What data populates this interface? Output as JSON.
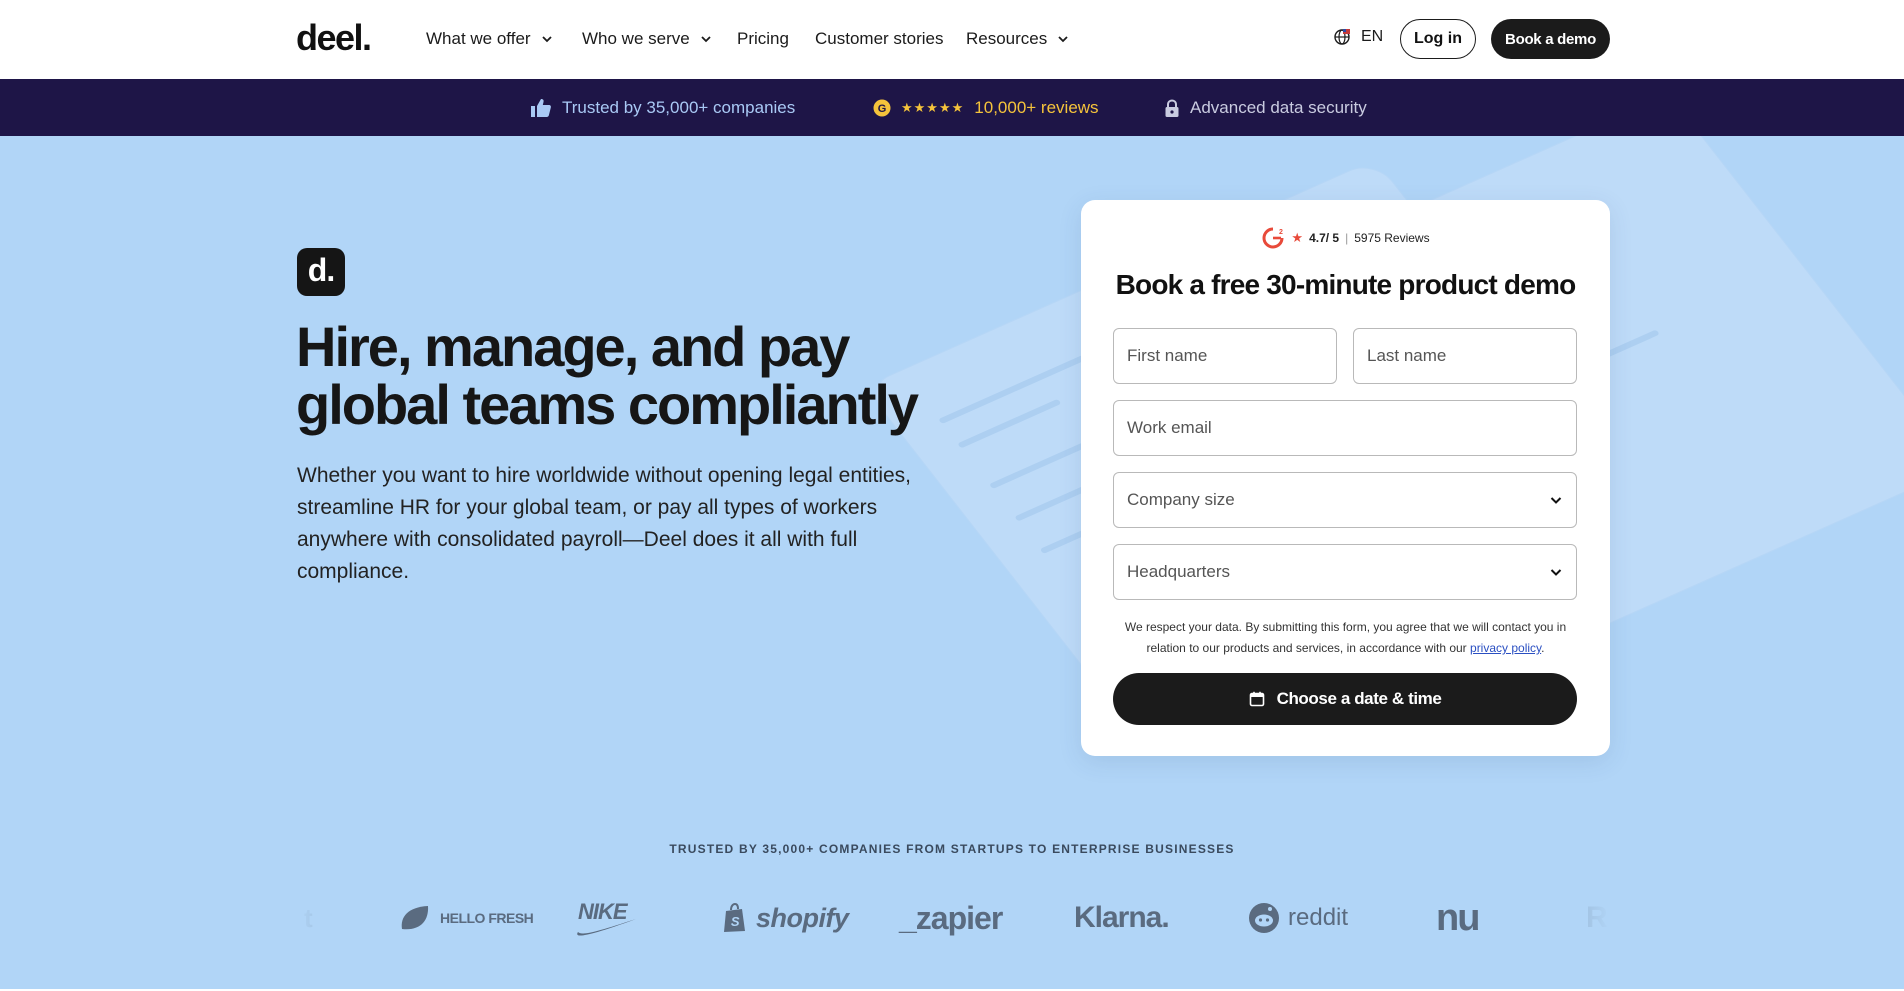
{
  "nav": {
    "logo": "deel.",
    "items": [
      {
        "label": "What we offer",
        "dropdown": true
      },
      {
        "label": "Who we serve",
        "dropdown": true
      },
      {
        "label": "Pricing",
        "dropdown": false
      },
      {
        "label": "Customer stories",
        "dropdown": false
      },
      {
        "label": "Resources",
        "dropdown": true
      }
    ],
    "language": "EN",
    "login_label": "Log in",
    "demo_label": "Book a demo"
  },
  "banner": {
    "trusted": "Trusted by 35,000+ companies",
    "stars": "★★★★★",
    "reviews": "10,000+ reviews",
    "security": "Advanced data security"
  },
  "hero": {
    "badge": "d.",
    "title": "Hire, manage, and pay global teams compliantly",
    "subtitle": "Whether you want to hire worldwide without opening legal entities, streamline HR for your global team, or pay all types of workers anywhere with consolidated payroll—Deel does it all with full compliance."
  },
  "form": {
    "rating_score": "4.7/ 5",
    "rating_sep": "|",
    "rating_reviews": "5975 Reviews",
    "title": "Book a free 30-minute  product demo",
    "first_name_placeholder": "First name",
    "last_name_placeholder": "Last name",
    "email_placeholder": "Work email",
    "company_size_placeholder": "Company size",
    "headquarters_placeholder": "Headquarters",
    "consent_text": "We respect your data. By submitting this form, you agree that we will contact you in relation to our products and services, in accordance with our ",
    "privacy_link": "privacy policy",
    "consent_end": ".",
    "submit_label": "Choose a date & time"
  },
  "logos": {
    "heading": "TRUSTED BY 35,000+ COMPANIES FROM STARTUPS TO ENTERPRISE BUSINESSES",
    "brands": [
      "HELLO FRESH",
      "NIKE",
      "shopify",
      "_zapier",
      "Klarna.",
      "reddit",
      "nu"
    ]
  },
  "colors": {
    "hero_bg": "#b1d5f7",
    "banner_bg": "#1e1547",
    "primary_button": "#1b1b1b",
    "banner_trusted": "#a9c9f5",
    "banner_reviews": "#f5c33b"
  }
}
